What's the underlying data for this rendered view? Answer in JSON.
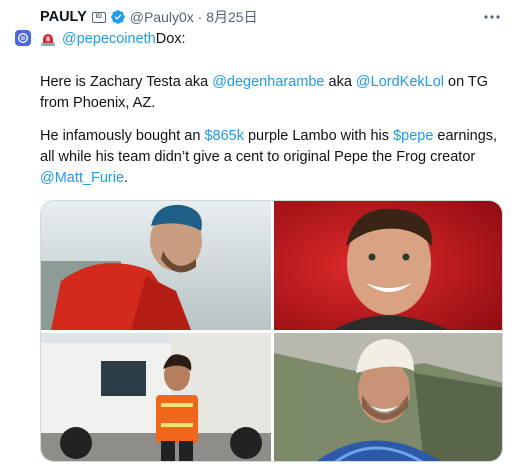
{
  "author": {
    "display_name": "PAULY",
    "id_badge_text": "ID",
    "handle_and_date": "@Pauly0x · 8月25日",
    "verified_color": "#1d9bf0"
  },
  "icons": {
    "more": "more-options-icon",
    "sidebar": "sidebar-app-icon",
    "siren": "siren-emoji-icon"
  },
  "tweet": {
    "line1": {
      "mention": "@pepecoineth",
      "rest": " Dox:"
    },
    "para1": {
      "t1": "Here is Zachary Testa aka ",
      "m1": "@degenharambe",
      "t2": " aka ",
      "m2": "@LordKekLol",
      "t3": " on TG from Phoenix, AZ."
    },
    "para2": {
      "t1": "He infamously bought an ",
      "cash": "$865k",
      "t2": " purple Lambo with his ",
      "cashtag": "$pepe",
      "t3": " earnings, all while his team didn’t give a cent to original Pepe the Frog creator ",
      "mention": "@Matt_Furie",
      "t4": "."
    }
  },
  "colors": {
    "link": "#1d9bf0",
    "text": "#0f1419",
    "secondary": "#536471"
  }
}
